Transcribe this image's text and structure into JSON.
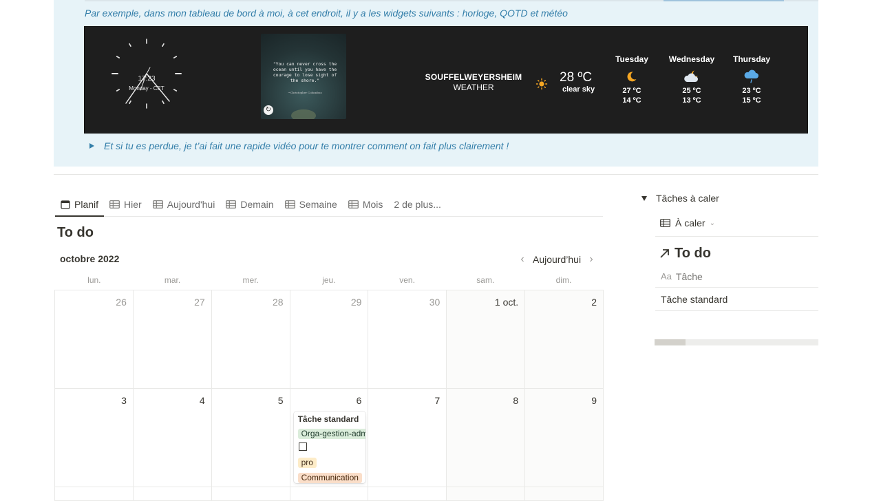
{
  "callout": {
    "intro_text": "Par exemple, dans mon tableau de bord à moi, à cet endroit, il y a les widgets suivants : horloge, QOTD et météo",
    "toggle_text": "Et si tu es perdue, je t’ai fait une rapide vidéo pour te montrer comment on fait plus clairement !"
  },
  "widgets": {
    "clock": {
      "time": "17:23",
      "date": "Monday - CET"
    },
    "qotd": {
      "quote": "\"You can never cross the ocean until you have the courage to lose sight of the shore.\"",
      "author": "~Christopher Columbus"
    },
    "weather": {
      "city": "SOUFFELWEYERSHEIM",
      "label": "WEATHER",
      "current_temp": "28 ºC",
      "current_condition": "clear sky",
      "current_icon": "sun-icon",
      "forecast": [
        {
          "day": "Tuesday",
          "icon": "moon-icon",
          "high": "27 ºC",
          "low": "14 ºC"
        },
        {
          "day": "Wednesday",
          "icon": "cloud-moon-icon",
          "high": "25 ºC",
          "low": "13 ºC"
        },
        {
          "day": "Thursday",
          "icon": "rain-cloud-icon",
          "high": "23 ºC",
          "low": "15 ºC"
        }
      ]
    }
  },
  "tabs": [
    {
      "label": "Planif",
      "icon": "calendar-icon",
      "active": true
    },
    {
      "label": "Hier",
      "icon": "table-icon"
    },
    {
      "label": "Aujourd'hui",
      "icon": "table-icon"
    },
    {
      "label": "Demain",
      "icon": "table-icon"
    },
    {
      "label": "Semaine",
      "icon": "table-icon"
    },
    {
      "label": "Mois",
      "icon": "table-icon"
    },
    {
      "label": "2 de plus..."
    }
  ],
  "calendar": {
    "title": "To do",
    "month": "octobre 2022",
    "today_label": "Aujourd’hui",
    "weekdays": [
      "lun.",
      "mar.",
      "mer.",
      "jeu.",
      "ven.",
      "sam.",
      "dim."
    ],
    "week1": [
      "26",
      "27",
      "28",
      "29",
      "30",
      "1 oct.",
      "2"
    ],
    "week2": [
      "3",
      "4",
      "5",
      "6",
      "7",
      "8",
      "9"
    ],
    "event": {
      "title": "Tâche standard",
      "tag1": "Orga-gestion-admin",
      "tag2": "pro",
      "tag3": "Communication"
    }
  },
  "side_panel": {
    "toggle_label": "Tâches à caler",
    "view_label": "À caler",
    "title": "To do",
    "column_header": "Tâche",
    "column_prefix": "Aa",
    "row": "Tâche standard"
  },
  "colors": {
    "callout_bg": "#e7f3f8",
    "callout_text": "#337ea9",
    "widget_bg": "#1e1e1e",
    "sun": "#f5a623"
  }
}
